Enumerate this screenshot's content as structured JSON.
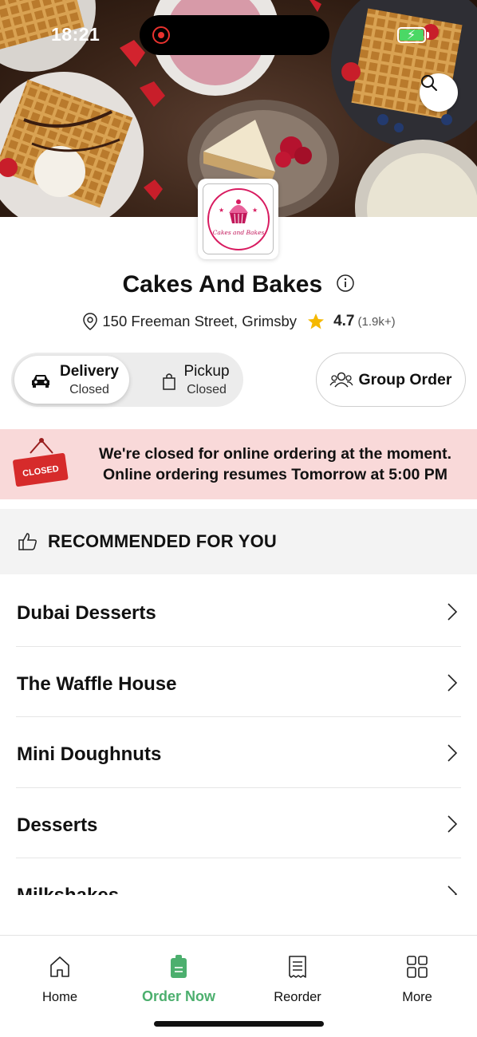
{
  "status_bar": {
    "time": "18:21"
  },
  "store": {
    "logo_text": "Cakes and Bakes",
    "name": "Cakes And Bakes",
    "address": "150 Freeman Street, Grimsby",
    "rating": "4.7",
    "rating_count": "(1.9k+)"
  },
  "order_mode": {
    "delivery": {
      "label": "Delivery",
      "status": "Closed"
    },
    "pickup": {
      "label": "Pickup",
      "status": "Closed"
    },
    "group_order_label": "Group Order"
  },
  "closed_banner": {
    "sign_text": "CLOSED",
    "line1": "We're closed for online ordering at the moment.",
    "line2": "Online ordering resumes Tomorrow at 5:00 PM"
  },
  "recommended": {
    "title": "RECOMMENDED FOR YOU"
  },
  "categories": [
    {
      "label": "Dubai Desserts"
    },
    {
      "label": "The Waffle House"
    },
    {
      "label": "Mini Doughnuts"
    },
    {
      "label": "Desserts"
    },
    {
      "label": "Milkshakes"
    }
  ],
  "bottom_nav": {
    "home": "Home",
    "order_now": "Order Now",
    "reorder": "Reorder",
    "more": "More"
  },
  "colors": {
    "accent_green": "#4caf6e",
    "brand_pink": "#d81b60",
    "closed_banner_bg": "#f9d9d9",
    "closed_sign_red": "#d62b2b",
    "star": "#f5b800"
  }
}
